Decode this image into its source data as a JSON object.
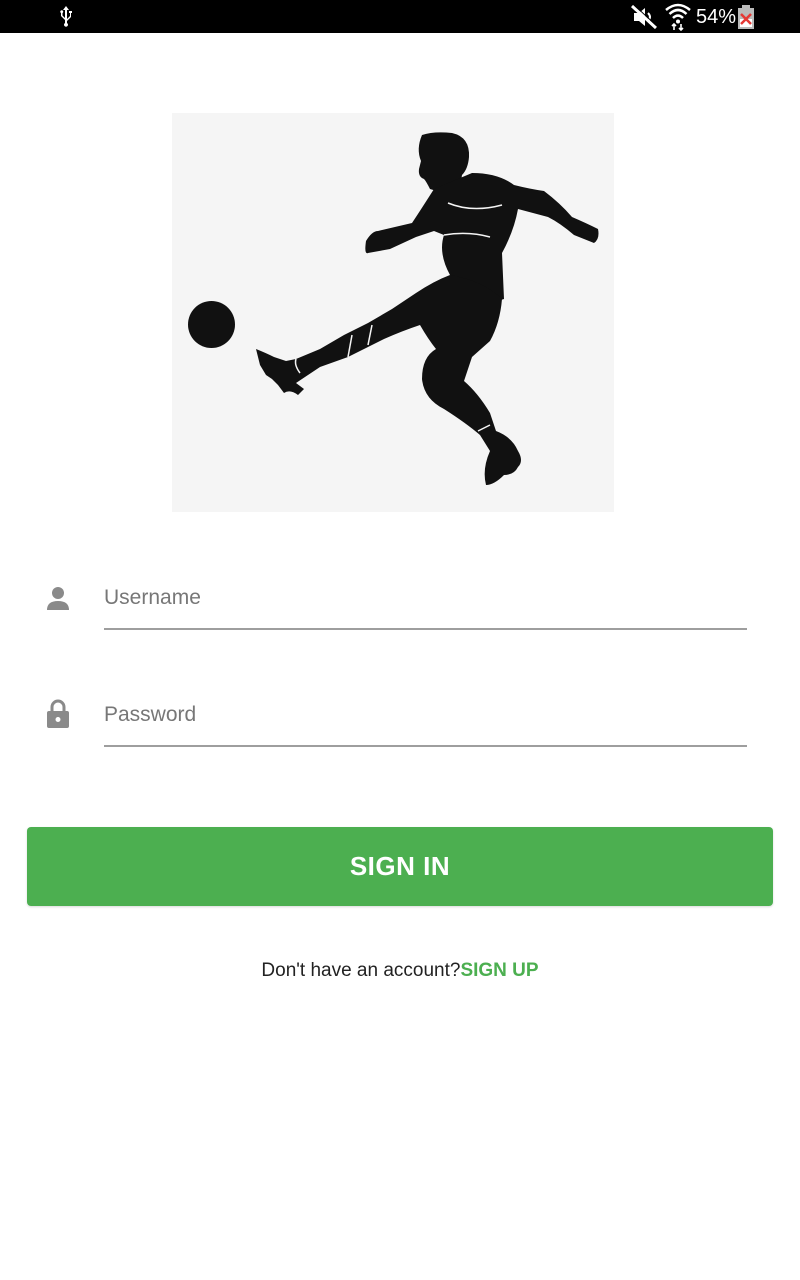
{
  "status_bar": {
    "battery_text": "54%",
    "icons": [
      "usb-icon",
      "mute-icon",
      "wifi-icon",
      "battery-icon"
    ]
  },
  "hero": {
    "image": "football-player-silhouette"
  },
  "form": {
    "username": {
      "placeholder": "Username",
      "value": "",
      "icon": "person-icon"
    },
    "password": {
      "placeholder": "Password",
      "value": "",
      "icon": "lock-icon"
    }
  },
  "signin_label": "SIGN IN",
  "signup": {
    "prompt": "Don't have an account?",
    "link": "SIGN UP"
  },
  "colors": {
    "accent": "#4caf50",
    "status_bar": "#000000",
    "hero_bg": "#f5f5f5",
    "underline": "#9e9e9e",
    "icon": "#8a8a8a"
  }
}
